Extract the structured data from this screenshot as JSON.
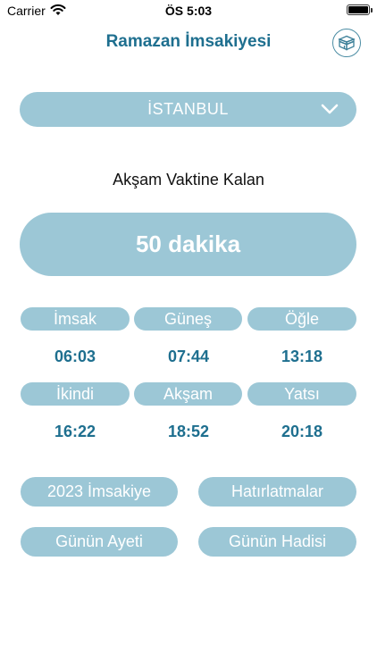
{
  "status_bar": {
    "carrier": "Carrier",
    "time": "ÖS 5:03",
    "wifi_icon": "wifi-icon",
    "battery_icon": "battery-icon"
  },
  "header": {
    "title": "Ramazan İmsakiyesi",
    "kaaba_icon": "kaaba-icon"
  },
  "city_select": {
    "selected": "İSTANBUL",
    "icon": "chevron-down-icon"
  },
  "countdown": {
    "label": "Akşam Vaktine Kalan",
    "value": "50 dakika"
  },
  "prayer_times": [
    {
      "name": "İmsak",
      "time": "06:03"
    },
    {
      "name": "Güneş",
      "time": "07:44"
    },
    {
      "name": "Öğle",
      "time": "13:18"
    },
    {
      "name": "İkindi",
      "time": "16:22"
    },
    {
      "name": "Akşam",
      "time": "18:52"
    },
    {
      "name": "Yatsı",
      "time": "20:18"
    }
  ],
  "menu": {
    "imsakiye": "2023 İmsakiye",
    "reminders": "Hatırlatmalar",
    "verse": "Günün Ayeti",
    "hadith": "Günün Hadisi"
  },
  "colors": {
    "accent": "#9cc7d6",
    "title": "#1e6f8f"
  }
}
